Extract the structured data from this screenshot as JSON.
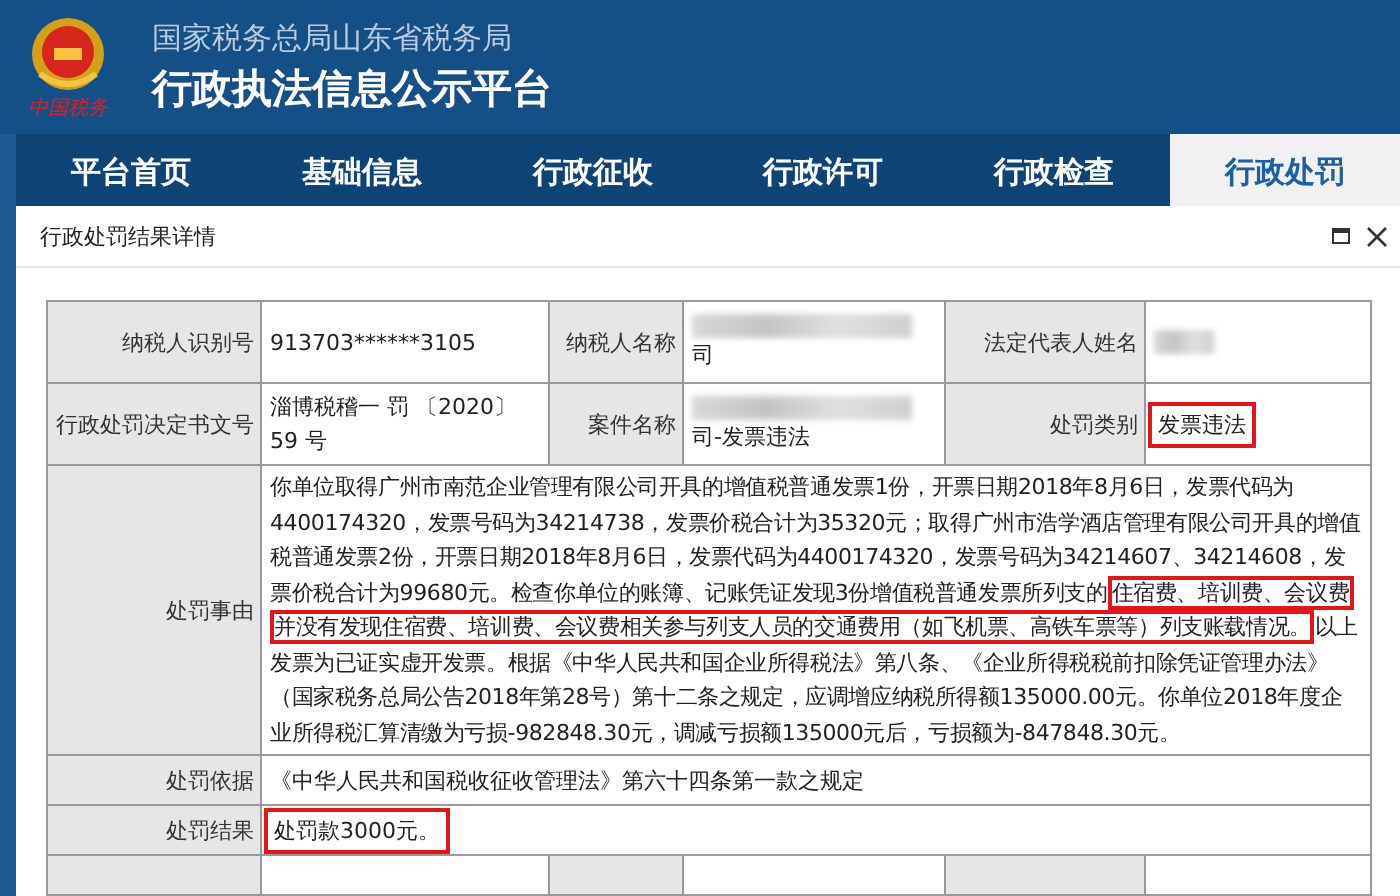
{
  "header": {
    "logo_caption": "中国税务",
    "org": "国家税务总局山东省税务局",
    "title": "行政执法信息公示平台"
  },
  "nav": [
    {
      "label": "平台首页",
      "selected": false
    },
    {
      "label": "基础信息",
      "selected": false
    },
    {
      "label": "行政征收",
      "selected": false
    },
    {
      "label": "行政许可",
      "selected": false
    },
    {
      "label": "行政检查",
      "selected": false
    },
    {
      "label": "行政处罚",
      "selected": true
    }
  ],
  "dialog": {
    "title": "行政处罚结果详情",
    "rows": [
      {
        "cells": [
          {
            "label": "纳税人识别号",
            "value": "913703******3105"
          },
          {
            "label": "纳税人名称",
            "value": "司",
            "redacted": true
          },
          {
            "label": "法定代表人姓名",
            "redacted": true
          }
        ]
      },
      {
        "cells": [
          {
            "label": "行政处罚决定书文号",
            "value": "淄博税稽一 罚 〔2020〕59 号"
          },
          {
            "label": "案件名称",
            "value": "司-发票违法",
            "redacted": true
          },
          {
            "label": "处罚类别",
            "value": "发票违法",
            "highlighted": true
          }
        ]
      },
      {
        "cells": [
          {
            "label": "处罚事由",
            "segments": [
              {
                "text": "你单位取得广州市南范企业管理有限公司开具的增值税普通发票1份，开票日期2018年8月6日，发票代码为4400174320，发票号码为34214738，发票价税合计为35320元；取得广州市浩学酒店管理有限公司开具的增值税普通发票2份，开票日期2018年8月6日，发票代码为4400174320，发票号码为34214607、34214608，发票价税合计为99680元。检查你单位的账簿、记账凭证发现3份增值税普通发票所列支的",
                "highlighted": false
              },
              {
                "text": "住宿费、培训费、会议费并没有发现住宿费、培训费、会议费相关参与列支人员的交通费用（如飞机票、高铁车票等）列支账载情况。",
                "highlighted": true
              },
              {
                "text": "以上发票为已证实虚开发票。根据《中华人民共和国企业所得税法》第八条、《企业所得税税前扣除凭证管理办法》（国家税务总局公告2018年第28号）第十二条之规定，应调增应纳税所得额135000.00元。你单位2018年度企业所得税汇算清缴为亏损-982848.30元，调减亏损额135000元后，亏损额为-847848.30元。",
                "highlighted": false
              }
            ]
          }
        ]
      },
      {
        "cells": [
          {
            "label": "处罚依据",
            "value": "《中华人民共和国税收征收管理法》第六十四条第一款之规定"
          }
        ]
      },
      {
        "cells": [
          {
            "label": "处罚结果",
            "value": "处罚款3000元。",
            "highlighted": true
          }
        ]
      }
    ]
  }
}
